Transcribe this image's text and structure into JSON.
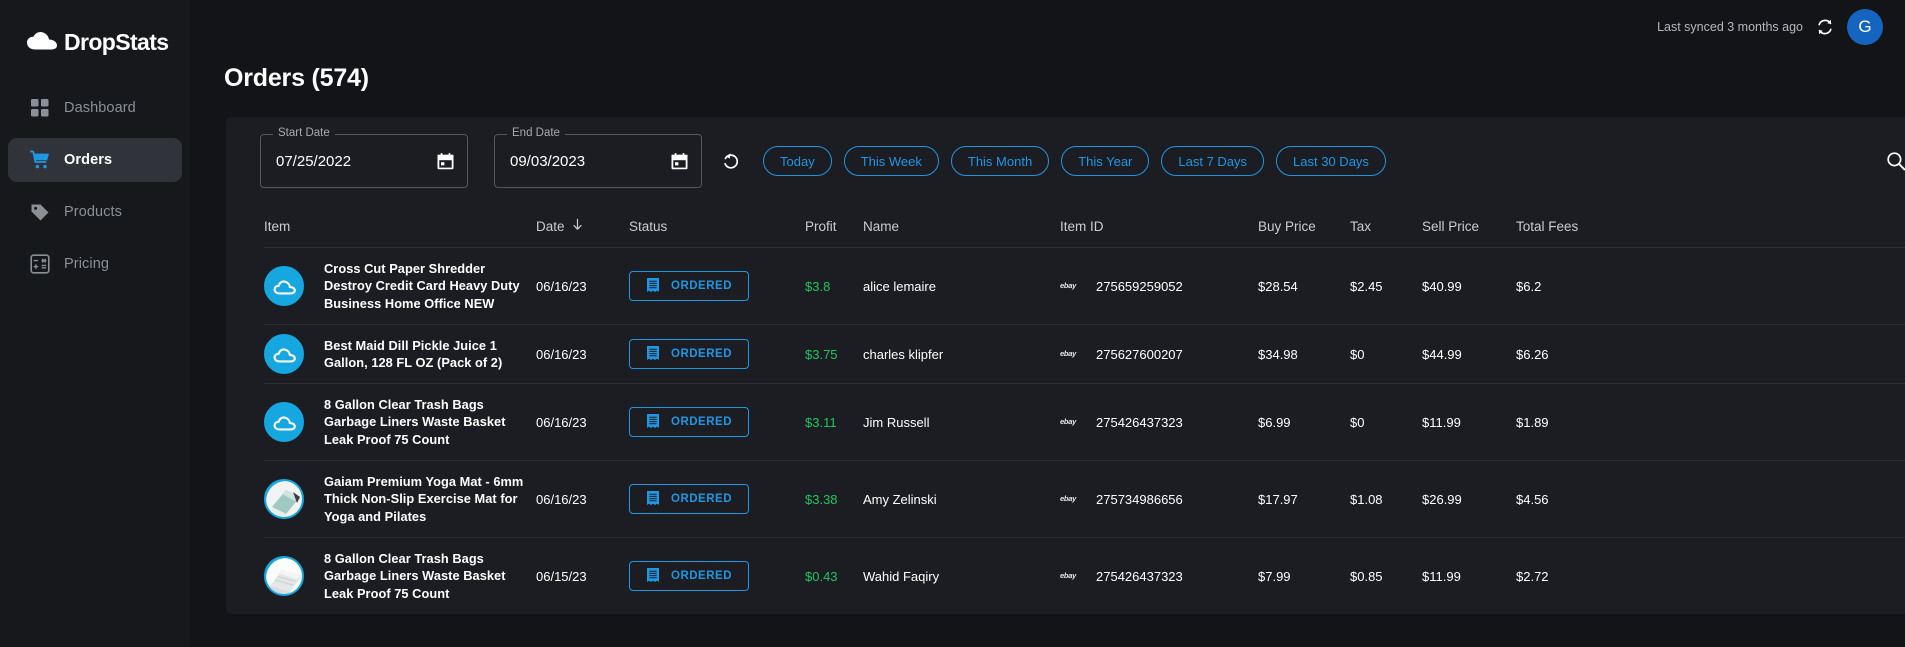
{
  "brand": {
    "name": "DropStats",
    "logo_icon": "cloud-icon"
  },
  "sidebar": {
    "items": [
      {
        "label": "Dashboard",
        "icon": "grid-icon",
        "active": false
      },
      {
        "label": "Orders",
        "icon": "cart-icon",
        "active": true
      },
      {
        "label": "Products",
        "icon": "tag-icon",
        "active": false
      },
      {
        "label": "Pricing",
        "icon": "calculator-icon",
        "active": false
      }
    ]
  },
  "topbar": {
    "sync_text": "Last synced 3 months ago",
    "sync_icon": "refresh-icon",
    "avatar_initial": "G",
    "avatar_color": "#1565c0"
  },
  "page": {
    "title": "Orders (574)"
  },
  "filters": {
    "start_date": {
      "label": "Start Date",
      "value": "07/25/2022",
      "icon": "calendar-icon"
    },
    "end_date": {
      "label": "End Date",
      "value": "09/03/2023",
      "icon": "calendar-icon"
    },
    "reset_icon": "reset-icon",
    "chips": [
      "Today",
      "This Week",
      "This Month",
      "This Year",
      "Last 7 Days",
      "Last 30 Days"
    ],
    "chip_color": "#2196e3",
    "toolbar_icons": [
      "search-icon",
      "cloud-download-icon",
      "print-icon",
      "columns-icon"
    ]
  },
  "table": {
    "columns": [
      {
        "key": "item",
        "label": "Item"
      },
      {
        "key": "date",
        "label": "Date",
        "sort": "desc",
        "sort_icon": "arrow-down-icon"
      },
      {
        "key": "status",
        "label": "Status"
      },
      {
        "key": "profit",
        "label": "Profit"
      },
      {
        "key": "name",
        "label": "Name"
      },
      {
        "key": "item_id",
        "label": "Item ID"
      },
      {
        "key": "buy",
        "label": "Buy Price"
      },
      {
        "key": "tax",
        "label": "Tax"
      },
      {
        "key": "sell",
        "label": "Sell Price"
      },
      {
        "key": "fees",
        "label": "Total Fees"
      }
    ],
    "rows": [
      {
        "thumb": "cloud-placeholder",
        "item": "Cross Cut Paper Shredder Destroy Credit Card Heavy Duty Business Home Office NEW",
        "date": "06/16/23",
        "status": "ORDERED",
        "status_icon": "receipt-icon",
        "profit": "$3.8",
        "name": "alice lemaire",
        "marketplace_icon": "ebay-icon",
        "item_id": "275659259052",
        "buy": "$28.54",
        "tax": "$2.45",
        "sell": "$40.99",
        "fees": "$6.2"
      },
      {
        "thumb": "cloud-placeholder",
        "item": "Best Maid Dill Pickle Juice 1 Gallon, 128 FL OZ (Pack of 2)",
        "date": "06/16/23",
        "status": "ORDERED",
        "status_icon": "receipt-icon",
        "profit": "$3.75",
        "name": "charles klipfer",
        "marketplace_icon": "ebay-icon",
        "item_id": "275627600207",
        "buy": "$34.98",
        "tax": "$0",
        "sell": "$44.99",
        "fees": "$6.26"
      },
      {
        "thumb": "cloud-placeholder",
        "item": "8 Gallon Clear Trash Bags Garbage Liners Waste Basket Leak Proof 75 Count",
        "date": "06/16/23",
        "status": "ORDERED",
        "status_icon": "receipt-icon",
        "profit": "$3.11",
        "name": "Jim Russell",
        "marketplace_icon": "ebay-icon",
        "item_id": "275426437323",
        "buy": "$6.99",
        "tax": "$0",
        "sell": "$11.99",
        "fees": "$1.89"
      },
      {
        "thumb": "yoga-mat-photo",
        "item": "Gaiam Premium Yoga Mat - 6mm Thick Non-Slip Exercise Mat for Yoga and Pilates",
        "date": "06/16/23",
        "status": "ORDERED",
        "status_icon": "receipt-icon",
        "profit": "$3.38",
        "name": "Amy Zelinski",
        "marketplace_icon": "ebay-icon",
        "item_id": "275734986656",
        "buy": "$17.97",
        "tax": "$1.08",
        "sell": "$26.99",
        "fees": "$4.56"
      },
      {
        "thumb": "trash-bag-photo",
        "item": "8 Gallon Clear Trash Bags Garbage Liners Waste Basket Leak Proof 75 Count",
        "date": "06/15/23",
        "status": "ORDERED",
        "status_icon": "receipt-icon",
        "profit": "$0.43",
        "name": "Wahid Faqiry",
        "marketplace_icon": "ebay-icon",
        "item_id": "275426437323",
        "buy": "$7.99",
        "tax": "$0.85",
        "sell": "$11.99",
        "fees": "$2.72"
      }
    ]
  }
}
